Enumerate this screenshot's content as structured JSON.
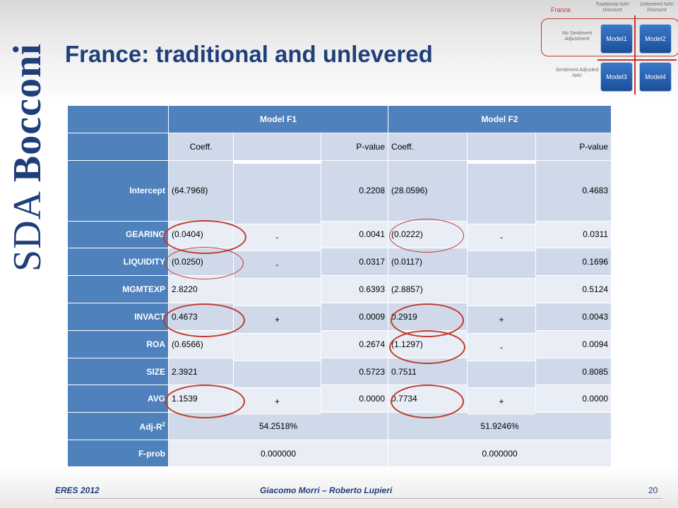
{
  "title": "France: traditional and unlevered",
  "logo": {
    "sda": "SDA ",
    "bocconi": "Bocconi"
  },
  "diagram": {
    "country": "France",
    "col1": "Traditional NAV Discount",
    "col2": "Unlevered NAV Discount",
    "row1": "No Sentiment Adjustment",
    "row2": "Sentiment Adjusted NAV",
    "models": [
      "Model1",
      "Model2",
      "Model3",
      "Model4"
    ]
  },
  "table": {
    "model_headers": [
      "Model F1",
      "Model F2"
    ],
    "sub_headers": [
      "Coeff.",
      "",
      "P-value",
      "Coeff.",
      "",
      "P-value"
    ],
    "rows": [
      {
        "label": "Intercept",
        "f1_coeff": "(64.7968)",
        "f1_sign": "",
        "f1_p": "0.2208",
        "f2_coeff": "(28.0596)",
        "f2_sign": "",
        "f2_p": "0.4683"
      },
      {
        "label": "GEARING",
        "f1_coeff": "(0.0404)",
        "f1_sign": "-",
        "f1_p": "0.0041",
        "f2_coeff": "(0.0222)",
        "f2_sign": "-",
        "f2_p": "0.0311"
      },
      {
        "label": "LIQUIDITY",
        "f1_coeff": "(0.0250)",
        "f1_sign": "-",
        "f1_p": "0.0317",
        "f2_coeff": "(0.0117)",
        "f2_sign": "",
        "f2_p": "0.1696"
      },
      {
        "label": "MGMTEXP",
        "f1_coeff": "2.8220",
        "f1_sign": "",
        "f1_p": "0.6393",
        "f2_coeff": "(2.8857)",
        "f2_sign": "",
        "f2_p": "0.5124"
      },
      {
        "label": "INVACT",
        "f1_coeff": "0.4673",
        "f1_sign": "+",
        "f1_p": "0.0009",
        "f2_coeff": "0.2919",
        "f2_sign": "+",
        "f2_p": "0.0043"
      },
      {
        "label": "ROA",
        "f1_coeff": "(0.6566)",
        "f1_sign": "",
        "f1_p": "0.2674",
        "f2_coeff": "(1.1297)",
        "f2_sign": "-",
        "f2_p": "0.0094"
      },
      {
        "label": "SIZE",
        "f1_coeff": "2.3921",
        "f1_sign": "",
        "f1_p": "0.5723",
        "f2_coeff": "0.7511",
        "f2_sign": "",
        "f2_p": "0.8085"
      },
      {
        "label": "AVG",
        "f1_coeff": "1.1539",
        "f1_sign": "+",
        "f1_p": "0.0000",
        "f2_coeff": "0.7734",
        "f2_sign": "+",
        "f2_p": "0.0000"
      }
    ],
    "adj_r2": {
      "label": "Adj-R",
      "sup": "2",
      "f1": "54.2518%",
      "f2": "51.9246%"
    },
    "fprob": {
      "label": "F-prob",
      "f1": "0.000000",
      "f2": "0.000000"
    }
  },
  "footer": {
    "left": "ERES 2012",
    "center": "Giacomo Morri – Roberto Lupieri",
    "page": "20"
  },
  "colors": {
    "header_blue": "#4f81bd",
    "cell_light": "#cfd9ea",
    "cell_lighter": "#e9eef6",
    "highlight_red": "#c0392b",
    "title_navy": "#1f3f7a"
  }
}
